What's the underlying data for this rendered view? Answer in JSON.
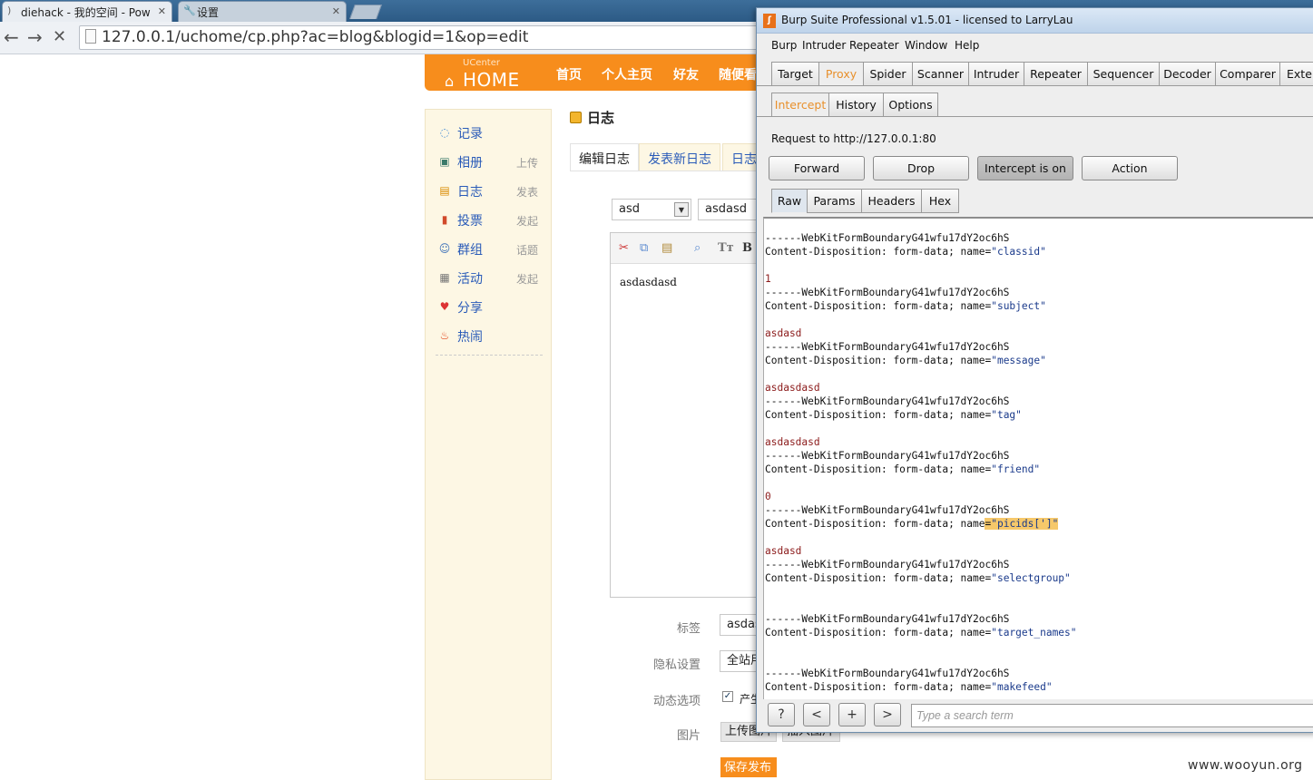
{
  "browser": {
    "tabs": [
      {
        "title": "diehack - 我的空间 - Pow",
        "active": true
      },
      {
        "title": "设置",
        "active": false
      }
    ],
    "url": "127.0.0.1/uchome/cp.php?ac=blog&blogid=1&op=edit"
  },
  "uch": {
    "logo_small": "UCenter",
    "logo_big": "HOME",
    "nav": [
      "首页",
      "个人主页",
      "好友",
      "随便看"
    ],
    "sidebar": [
      {
        "label": "记录",
        "side": "",
        "icon": "chat-icon"
      },
      {
        "label": "相册",
        "side": "上传",
        "icon": "photo-icon"
      },
      {
        "label": "日志",
        "side": "发表",
        "icon": "blog-icon"
      },
      {
        "label": "投票",
        "side": "发起",
        "icon": "poll-icon"
      },
      {
        "label": "群组",
        "side": "话题",
        "icon": "group-icon"
      },
      {
        "label": "活动",
        "side": "发起",
        "icon": "calendar-icon"
      },
      {
        "label": "分享",
        "side": "",
        "icon": "share-icon"
      },
      {
        "label": "热闹",
        "side": "",
        "icon": "fire-icon"
      }
    ],
    "page_title": "日志",
    "tabs": [
      "编辑日志",
      "发表新日志",
      "日志"
    ],
    "classid_value": "asd",
    "subject_value": "asdasd",
    "editor_content": "asdasdasd",
    "tag_label": "标签",
    "tag_value": "asdasdasd",
    "privacy_label": "隐私设置",
    "privacy_value": "全站用户可见",
    "feed_label": "动态选项",
    "feed_value": "产生动态",
    "pic_label": "图片",
    "upload_pic": "上传图片",
    "insert_pic": "插入图片",
    "submit": "保存发布"
  },
  "burp": {
    "title": "Burp Suite Professional v1.5.01 - licensed to LarryLau",
    "menu": [
      "Burp",
      "Intruder",
      "Repeater",
      "Window",
      "Help"
    ],
    "tools": [
      "Target",
      "Proxy",
      "Spider",
      "Scanner",
      "Intruder",
      "Repeater",
      "Sequencer",
      "Decoder",
      "Comparer",
      "Exter"
    ],
    "proxy_tabs": [
      "Intercept",
      "History",
      "Options"
    ],
    "request_to": "Request to http://127.0.0.1:80",
    "buttons": [
      "Forward",
      "Drop",
      "Intercept is on",
      "Action"
    ],
    "view_tabs": [
      "Raw",
      "Params",
      "Headers",
      "Hex"
    ],
    "boundary": "------WebKitFormBoundaryG41wfu17dY2oc6hS",
    "cd_prefix": "Content-Disposition: form-data; name=",
    "request_lines": [
      {
        "type": "boundary"
      },
      {
        "type": "cd",
        "name": "\"classid\""
      },
      {
        "type": "blank"
      },
      {
        "type": "value",
        "text": "1"
      },
      {
        "type": "boundary"
      },
      {
        "type": "cd",
        "name": "\"subject\""
      },
      {
        "type": "blank"
      },
      {
        "type": "value",
        "text": "asdasd"
      },
      {
        "type": "boundary"
      },
      {
        "type": "cd",
        "name": "\"message\""
      },
      {
        "type": "blank"
      },
      {
        "type": "value",
        "text": "asdasdasd"
      },
      {
        "type": "boundary"
      },
      {
        "type": "cd",
        "name": "\"tag\""
      },
      {
        "type": "blank"
      },
      {
        "type": "value",
        "text": "asdasdasd"
      },
      {
        "type": "boundary"
      },
      {
        "type": "cd",
        "name": "\"friend\""
      },
      {
        "type": "blank"
      },
      {
        "type": "value",
        "text": "0"
      },
      {
        "type": "boundary"
      },
      {
        "type": "cd",
        "name": "\"picids[']\"",
        "highlight": true
      },
      {
        "type": "blank"
      },
      {
        "type": "value",
        "text": "asdasd"
      },
      {
        "type": "boundary"
      },
      {
        "type": "cd",
        "name": "\"selectgroup\""
      },
      {
        "type": "blank"
      },
      {
        "type": "blank"
      },
      {
        "type": "boundary"
      },
      {
        "type": "cd",
        "name": "\"target_names\""
      },
      {
        "type": "blank"
      },
      {
        "type": "blank"
      },
      {
        "type": "boundary"
      },
      {
        "type": "cd",
        "name": "\"makefeed\""
      }
    ],
    "bottom_buttons": [
      "?",
      "<",
      "+",
      ">"
    ],
    "search_placeholder": "Type a search term"
  },
  "watermark": "www.wooyun.org"
}
